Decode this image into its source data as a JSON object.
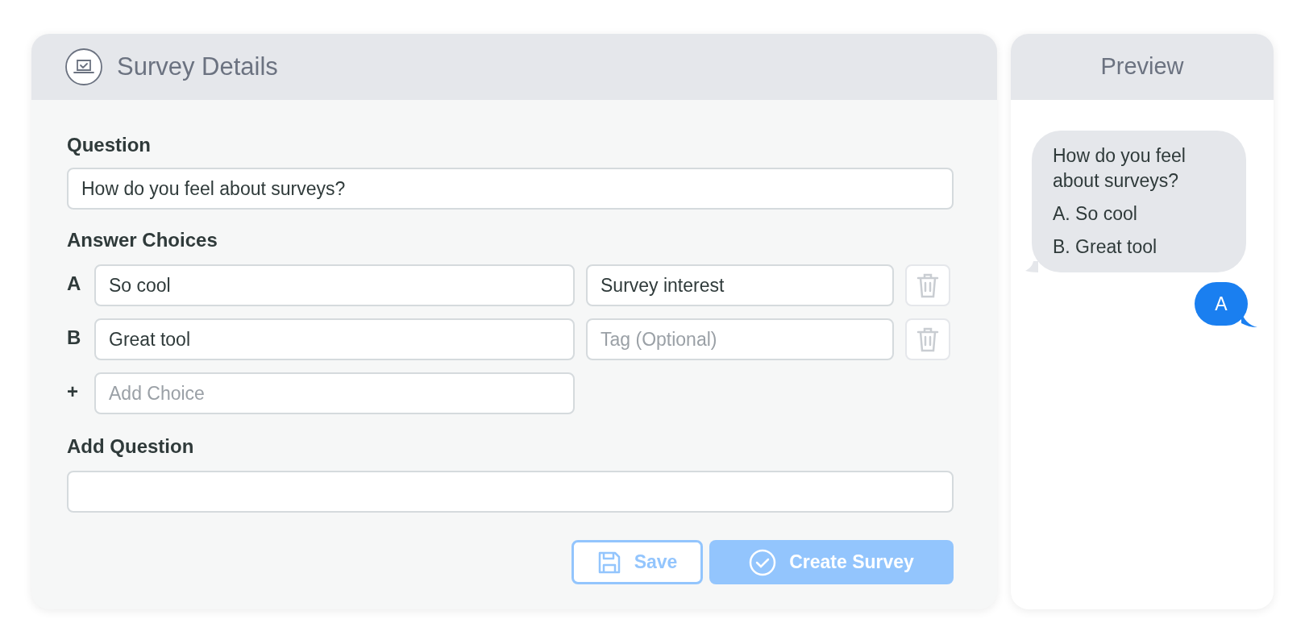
{
  "details": {
    "title": "Survey Details",
    "question_label": "Question",
    "question_value": "How do you feel about surveys?",
    "choices_label": "Answer Choices",
    "choices": [
      {
        "letter": "A",
        "value": "So cool",
        "tag": {
          "value": "Survey interest"
        }
      },
      {
        "letter": "B",
        "value": "Great tool",
        "tag": {
          "placeholder": "Tag (Optional)"
        }
      }
    ],
    "add_choice": {
      "marker": "+",
      "placeholder": "Add Choice"
    },
    "add_question_label": "Add Question",
    "buttons": [
      {
        "kind": "outline",
        "label": "Save",
        "disabled": true
      },
      {
        "kind": "primary",
        "label": "Create Survey",
        "disabled": true
      }
    ]
  },
  "preview": {
    "title": "Preview",
    "messages": [
      {
        "kind": "incoming",
        "lines": [
          "How do you feel about surveys?",
          "A. So cool",
          "B. Great tool"
        ]
      },
      {
        "kind": "outgoing",
        "lines": [
          "A"
        ]
      }
    ]
  }
}
